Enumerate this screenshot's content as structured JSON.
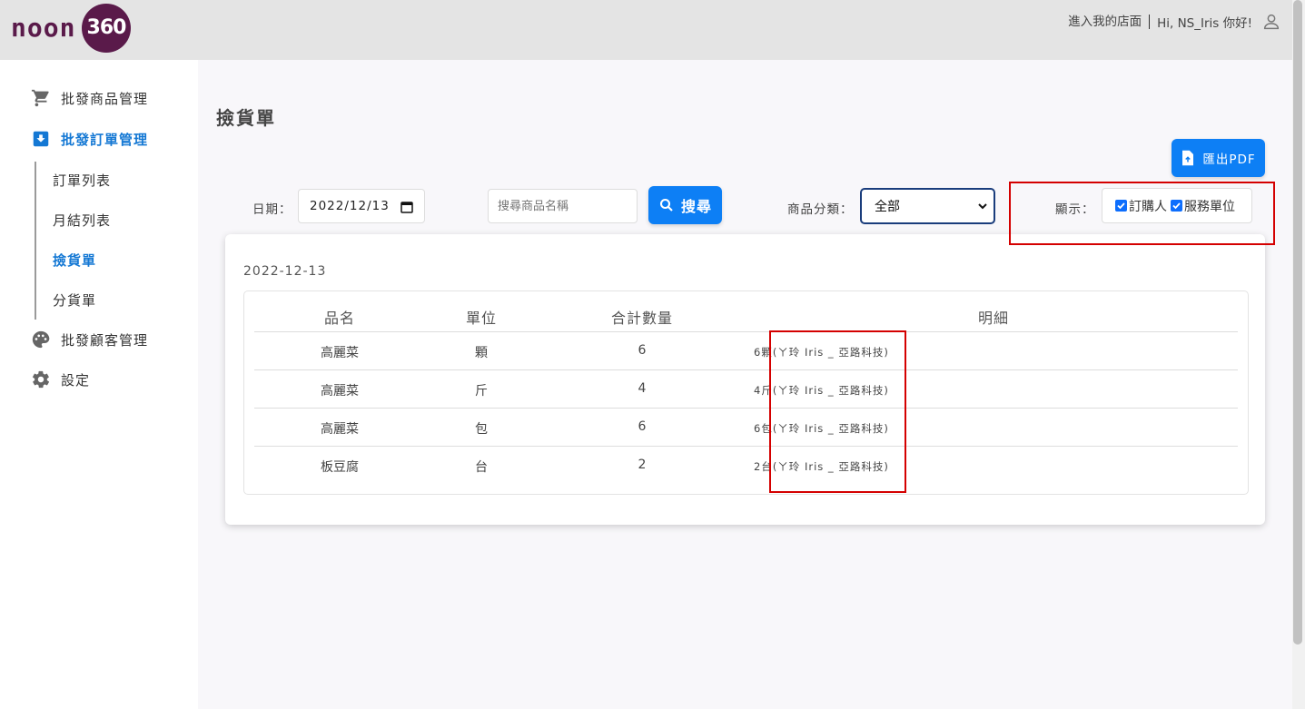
{
  "header": {
    "logo_text": "noon",
    "logo_num": "360",
    "store_link": "進入我的店面",
    "greeting": "Hi, NS_Iris 你好!"
  },
  "sidebar": {
    "items": [
      {
        "label": "批發商品管理"
      },
      {
        "label": "批發訂單管理"
      },
      {
        "label": "批發顧客管理"
      },
      {
        "label": "設定"
      }
    ],
    "sub_items": [
      {
        "label": "訂單列表"
      },
      {
        "label": "月結列表"
      },
      {
        "label": "撿貨單"
      },
      {
        "label": "分貨單"
      }
    ]
  },
  "main": {
    "title": "撿貨單",
    "export_label": "匯出PDF",
    "filters": {
      "date_label": "日期：",
      "date_value": "2022/12/13",
      "search_placeholder": "搜尋商品名稱",
      "search_button": "搜尋",
      "category_label": "商品分類：",
      "category_value": "全部",
      "display_label": "顯示：",
      "checkbox_buyer": "訂購人",
      "checkbox_unit": "服務單位"
    },
    "card": {
      "date": "2022-12-13",
      "columns": [
        "品名",
        "單位",
        "合計數量",
        "明細"
      ],
      "rows": [
        {
          "name": "高麗菜",
          "unit": "顆",
          "qty": "6",
          "detail": "6顆(ㄚ玲 Iris _ 亞路科技)"
        },
        {
          "name": "高麗菜",
          "unit": "斤",
          "qty": "4",
          "detail": "4斤(ㄚ玲 Iris _ 亞路科技)"
        },
        {
          "name": "高麗菜",
          "unit": "包",
          "qty": "6",
          "detail": "6包(ㄚ玲 Iris _ 亞路科技)"
        },
        {
          "name": "板豆腐",
          "unit": "台",
          "qty": "2",
          "detail": "2台(ㄚ玲 Iris _ 亞路科技)"
        }
      ]
    }
  },
  "colors": {
    "accent": "#0d7ff5",
    "active_nav": "#1478d4",
    "logo": "#5a1a4a",
    "highlight": "#d40000"
  }
}
